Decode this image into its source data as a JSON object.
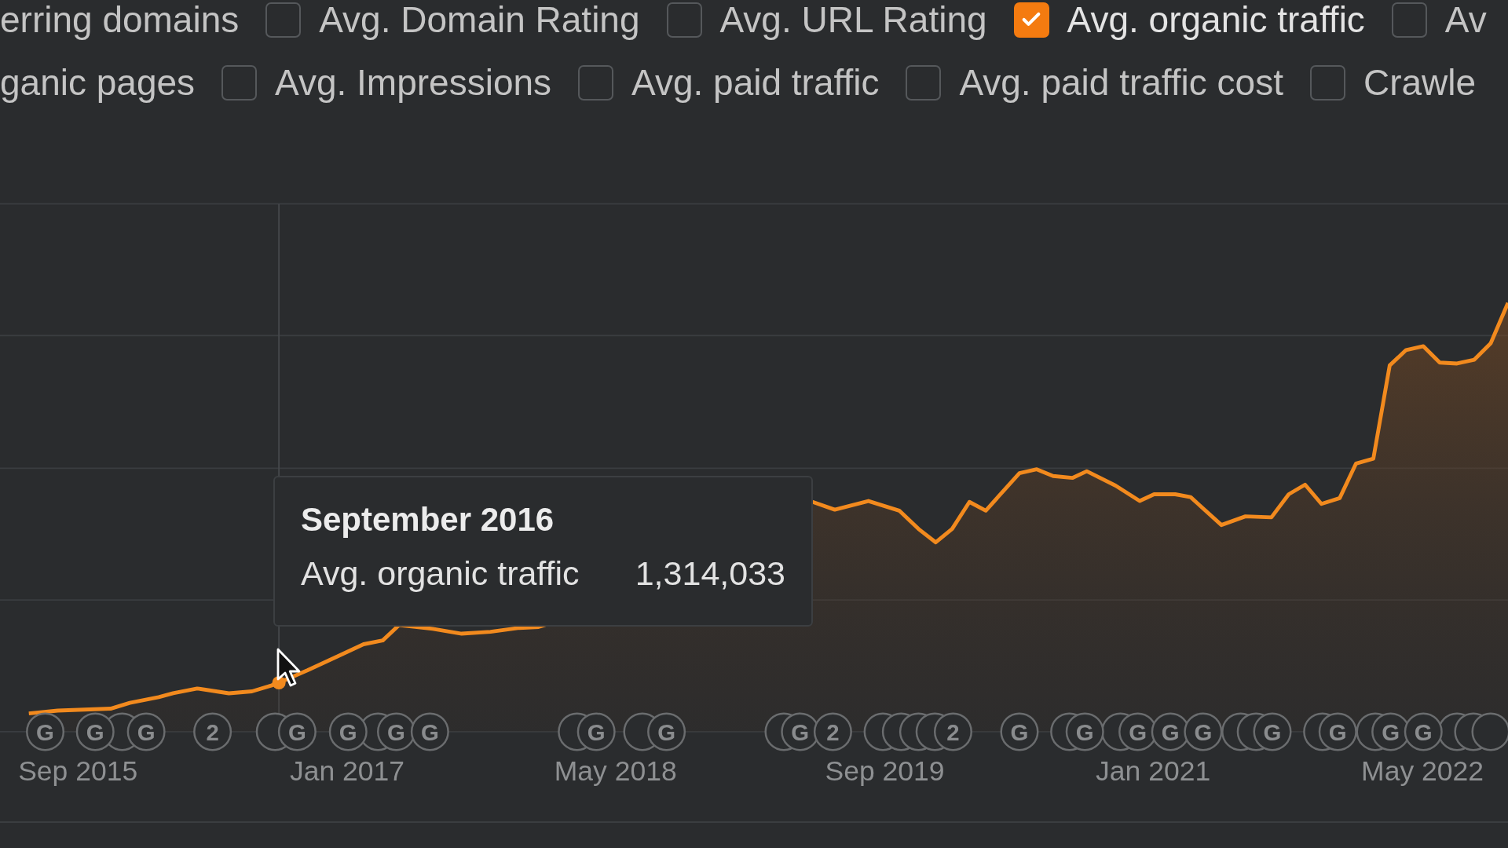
{
  "metric_rows": [
    [
      {
        "kind": "cut",
        "label": "erring domains"
      },
      {
        "kind": "checkbox",
        "label": "Avg. Domain Rating",
        "checked": false
      },
      {
        "kind": "checkbox",
        "label": "Avg. URL Rating",
        "checked": false
      },
      {
        "kind": "checkbox",
        "label": "Avg. organic traffic",
        "checked": true
      },
      {
        "kind": "checkbox",
        "label": "Av",
        "checked": false
      }
    ],
    [
      {
        "kind": "cut",
        "label": "ganic pages"
      },
      {
        "kind": "checkbox",
        "label": "Avg. Impressions",
        "checked": false
      },
      {
        "kind": "checkbox",
        "label": "Avg. paid traffic",
        "checked": false
      },
      {
        "kind": "checkbox",
        "label": "Avg. paid traffic cost",
        "checked": false
      },
      {
        "kind": "checkbox",
        "label": "Crawle",
        "checked": false
      }
    ]
  ],
  "chart": {
    "x_labels": [
      "Sep 2015",
      "Jan 2017",
      "May 2018",
      "Sep 2019",
      "Jan 2021",
      "May 2022"
    ],
    "markers": [
      {
        "kind": "labeled",
        "label": "G"
      },
      {
        "kind": "labeled",
        "label": "G"
      },
      {
        "kind": "covered"
      },
      {
        "kind": "labeled",
        "label": "G"
      },
      {
        "kind": "labeled",
        "label": "2"
      },
      {
        "kind": "covered"
      },
      {
        "kind": "labeled",
        "label": "G"
      },
      {
        "kind": "labeled",
        "label": "G"
      },
      {
        "kind": "covered"
      },
      {
        "kind": "labeled",
        "label": "G"
      },
      {
        "kind": "labeled",
        "label": "G"
      },
      {
        "kind": "covered"
      },
      {
        "kind": "labeled",
        "label": "G"
      },
      {
        "kind": "covered"
      },
      {
        "kind": "labeled",
        "label": "G"
      },
      {
        "kind": "covered"
      },
      {
        "kind": "labeled",
        "label": "G"
      },
      {
        "kind": "labeled",
        "label": "2"
      },
      {
        "kind": "covered"
      },
      {
        "kind": "covered"
      },
      {
        "kind": "covered"
      },
      {
        "kind": "covered"
      },
      {
        "kind": "labeled",
        "label": "2"
      },
      {
        "kind": "labeled",
        "label": "G"
      },
      {
        "kind": "covered"
      },
      {
        "kind": "labeled",
        "label": "G"
      },
      {
        "kind": "covered"
      },
      {
        "kind": "labeled",
        "label": "G"
      },
      {
        "kind": "labeled",
        "label": "G"
      },
      {
        "kind": "labeled",
        "label": "G"
      },
      {
        "kind": "covered"
      },
      {
        "kind": "covered"
      },
      {
        "kind": "labeled",
        "label": "G"
      },
      {
        "kind": "covered"
      },
      {
        "kind": "labeled",
        "label": "G"
      },
      {
        "kind": "covered"
      },
      {
        "kind": "labeled",
        "label": "G"
      },
      {
        "kind": "labeled",
        "label": "G"
      },
      {
        "kind": "covered"
      },
      {
        "kind": "covered"
      },
      {
        "kind": "covered"
      }
    ]
  },
  "tooltip": {
    "title": "September 2016",
    "metric": "Avg. organic traffic",
    "value": "1,314,033"
  }
}
